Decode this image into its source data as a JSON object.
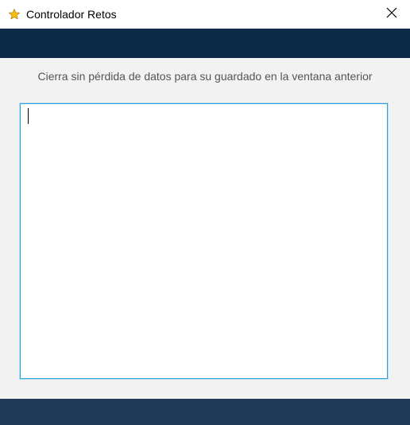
{
  "window": {
    "title": "Controlador Retos",
    "app_icon": "star-icon",
    "close_icon": "close-icon"
  },
  "colors": {
    "header_band": "#0d2b47",
    "footer_band": "#1f3a57",
    "background": "#f2f2f2",
    "textarea_border": "#29a3e0",
    "message_text": "#555555",
    "star_fill": "#f5c211"
  },
  "main": {
    "message": "Cierra sin pérdida de datos para su guardado en la ventana anterior",
    "textarea": {
      "value": ""
    }
  }
}
